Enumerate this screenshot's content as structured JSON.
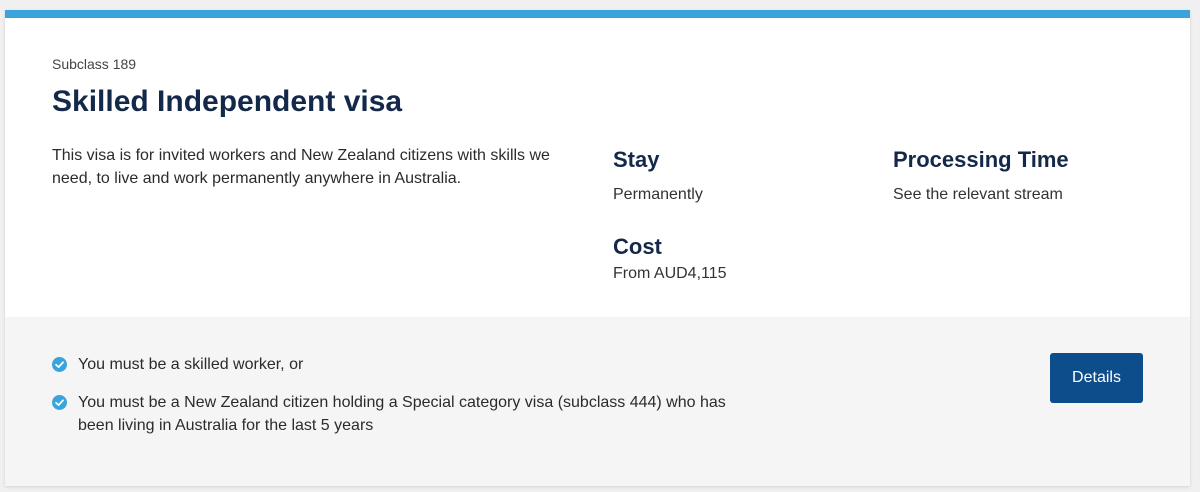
{
  "visa": {
    "subclass": "Subclass 189",
    "title": "Skilled Independent visa",
    "description": "This visa is for invited workers and New Zealand citizens with skills we need, to live and work permanently anywhere in Australia."
  },
  "info": {
    "stay": {
      "heading": "Stay",
      "value": "Permanently"
    },
    "processing": {
      "heading": "Processing Time",
      "value": "See the relevant stream"
    },
    "cost": {
      "heading": "Cost",
      "value": "From AUD4,115"
    }
  },
  "requirements": [
    "You must be a skilled worker, or",
    "You must be a New Zealand citizen holding a Special category visa (subclass 444) who has been living in Australia for the last 5 years"
  ],
  "details_button": {
    "label": "Details"
  },
  "colors": {
    "accent_bar": "#3aa4dc",
    "heading": "#14294a",
    "button": "#0e4d8b",
    "check": "#3aa4dc"
  },
  "icons": {
    "requirement": "check-circle-icon"
  }
}
